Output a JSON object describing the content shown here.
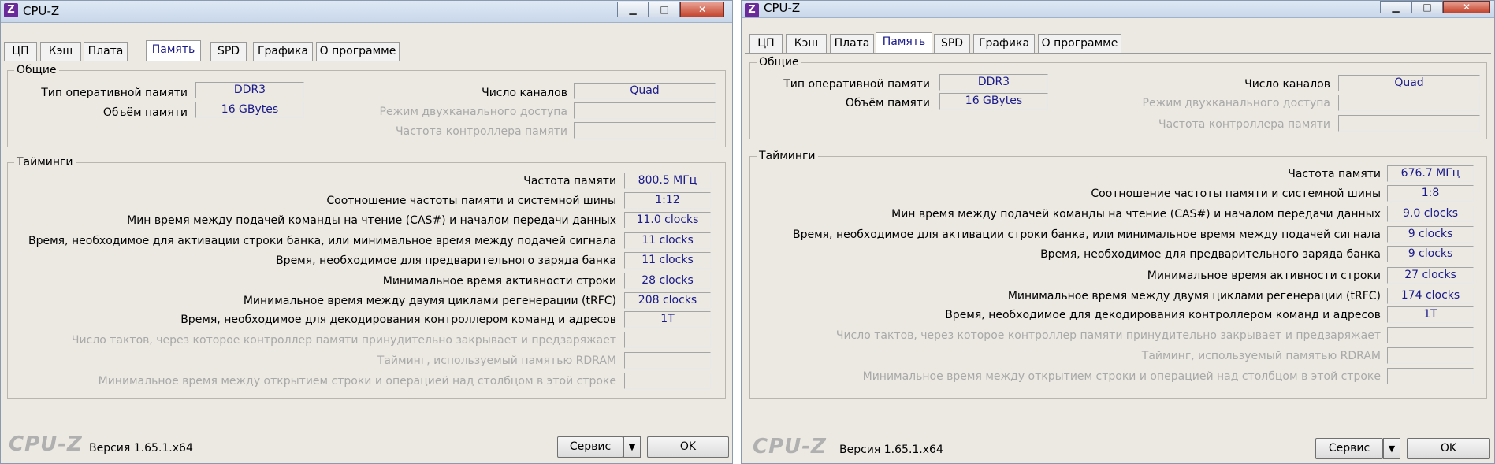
{
  "windows": [
    {
      "title": "CPU-Z",
      "icon_letter": "Z",
      "controls": {
        "minimize": "▁",
        "maximize": "□",
        "close": "✕"
      },
      "tabs": [
        "ЦП",
        "Кэш",
        "Плата",
        "Память",
        "SPD",
        "Графика",
        "О программе"
      ],
      "active_tab": "Память",
      "general": {
        "title": "Общие",
        "type_label": "Тип оперативной памяти",
        "type_value": "DDR3",
        "size_label": "Объём памяти",
        "size_value": "16 GBytes",
        "channels_label": "Число каналов",
        "channels_value": "Quad",
        "dc_mode_label": "Режим двухканального доступа",
        "dc_mode_value": "",
        "nb_freq_label": "Частота контроллера памяти",
        "nb_freq_value": ""
      },
      "timings": {
        "title": "Тайминги",
        "rows": [
          {
            "label": "Частота памяти",
            "value": "800.5 МГц",
            "enabled": true
          },
          {
            "label": "Соотношение частоты памяти и системной шины",
            "value": "1:12",
            "enabled": true
          },
          {
            "label": "Мин время между подачей команды на чтение (CAS#) и началом передачи данных",
            "value": "11.0 clocks",
            "enabled": true
          },
          {
            "label": "Время, необходимое для активации строки банка, или минимальное время между подачей сигнала",
            "value": "11 clocks",
            "enabled": true
          },
          {
            "label": "Время, необходимое для предварительного заряда банка",
            "value": "11 clocks",
            "enabled": true
          },
          {
            "label": "Минимальное время активности строки",
            "value": "28 clocks",
            "enabled": true
          },
          {
            "label": "Минимальное время между двумя циклами регенерации (tRFC)",
            "value": "208 clocks",
            "enabled": true
          },
          {
            "label": "Время, необходимое для декодирования контроллером команд и адресов",
            "value": "1T",
            "enabled": true
          },
          {
            "label": "Число тактов, через которое контроллер памяти принудительно закрывает и предзаряжает",
            "value": "",
            "enabled": false
          },
          {
            "label": "Тайминг, используемый памятью RDRAM",
            "value": "",
            "enabled": false
          },
          {
            "label": "Минимальное время между открытием строки и операцией над столбцом в этой строке",
            "value": "",
            "enabled": false
          }
        ]
      },
      "footer": {
        "logo": "CPU-Z",
        "version": "Версия 1.65.1.x64",
        "service_button": "Сервис",
        "dropdown_arrow": "▼",
        "ok_button": "OK"
      }
    },
    {
      "title": "CPU-Z",
      "icon_letter": "Z",
      "controls": {
        "minimize": "▁",
        "maximize": "□",
        "close": "✕"
      },
      "tabs": [
        "ЦП",
        "Кэш",
        "Плата",
        "Память",
        "SPD",
        "Графика",
        "О программе"
      ],
      "active_tab": "Память",
      "general": {
        "title": "Общие",
        "type_label": "Тип оперативной памяти",
        "type_value": "DDR3",
        "size_label": "Объём памяти",
        "size_value": "16 GBytes",
        "channels_label": "Число каналов",
        "channels_value": "Quad",
        "dc_mode_label": "Режим двухканального доступа",
        "dc_mode_value": "",
        "nb_freq_label": "Частота контроллера памяти",
        "nb_freq_value": ""
      },
      "timings": {
        "title": "Тайминги",
        "rows": [
          {
            "label": "Частота памяти",
            "value": "676.7 МГц",
            "enabled": true
          },
          {
            "label": "Соотношение частоты памяти и системной шины",
            "value": "1:8",
            "enabled": true
          },
          {
            "label": "Мин время между подачей команды на чтение (CAS#) и началом передачи данных",
            "value": "9.0 clocks",
            "enabled": true
          },
          {
            "label": "Время, необходимое для активации строки банка, или минимальное время между подачей сигнала",
            "value": "9 clocks",
            "enabled": true
          },
          {
            "label": "Время, необходимое для предварительного заряда банка",
            "value": "9 clocks",
            "enabled": true
          },
          {
            "label": "Минимальное время активности строки",
            "value": "27 clocks",
            "enabled": true
          },
          {
            "label": "Минимальное время между двумя циклами регенерации (tRFC)",
            "value": "174 clocks",
            "enabled": true
          },
          {
            "label": "Время, необходимое для декодирования контроллером команд и адресов",
            "value": "1T",
            "enabled": true
          },
          {
            "label": "Число тактов, через которое контроллер памяти принудительно закрывает и предзаряжает",
            "value": "",
            "enabled": false
          },
          {
            "label": "Тайминг, используемый памятью RDRAM",
            "value": "",
            "enabled": false
          },
          {
            "label": "Минимальное время между открытием строки и операцией над столбцом в этой строке",
            "value": "",
            "enabled": false
          }
        ]
      },
      "footer": {
        "logo": "CPU-Z",
        "version": "Версия 1.65.1.x64",
        "service_button": "Сервис",
        "dropdown_arrow": "▼",
        "ok_button": "OK"
      }
    }
  ]
}
